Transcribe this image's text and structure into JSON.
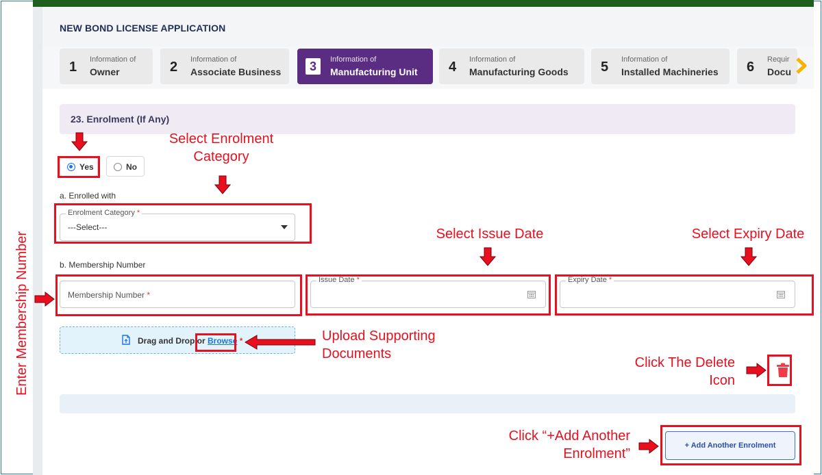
{
  "app": {
    "title": "NEW BOND LICENSE APPLICATION"
  },
  "steps": [
    {
      "num": "1",
      "small": "Information of",
      "big": "Owner",
      "active": false
    },
    {
      "num": "2",
      "small": "Information of",
      "big": "Associate Business",
      "active": false
    },
    {
      "num": "3",
      "small": "Information of",
      "big": "Manufacturing Unit",
      "active": true
    },
    {
      "num": "4",
      "small": "Information of",
      "big": "Manufacturing Goods",
      "active": false
    },
    {
      "num": "5",
      "small": "Information of",
      "big": "Installed Machineries",
      "active": false
    },
    {
      "num": "6",
      "small": "Requir",
      "big": "Docu",
      "active": false
    }
  ],
  "section": {
    "title": "23. Enrolment (If Any)"
  },
  "radio": {
    "yes_label": "Yes",
    "no_label": "No",
    "selected": "Yes"
  },
  "enrolled_with": {
    "label": "a. Enrolled with",
    "category_legend": "Enrolment Category",
    "category_value": "---Select---"
  },
  "membership": {
    "label": "b. Membership Number",
    "number_placeholder": "Membership Number",
    "issue_legend": "Issue Date",
    "expiry_legend": "Expiry Date"
  },
  "upload": {
    "prefix": "Drag and Drop or ",
    "browse": "Browse"
  },
  "required_mark": "*",
  "add_button": {
    "label": "+ Add Another Enrolment"
  },
  "annotations": {
    "select_category_1": "Select Enrolment",
    "select_category_2": "Category",
    "issue_date": "Select Issue Date",
    "expiry_date": "Select Expiry Date",
    "upload_1": "Upload Supporting",
    "upload_2": "Documents",
    "delete_1": "Click The Delete",
    "delete_2": "Icon",
    "add_1": "Click “+Add Another",
    "add_2": "Enrolment”",
    "membership": "Enter Membership Number"
  },
  "colors": {
    "annotation": "#e8101f",
    "active_step": "#5a2d82",
    "topbar": "#1e5e1e",
    "link": "#1a73e8"
  },
  "icons": [
    "calendar-icon",
    "upload-file-icon",
    "trash-icon",
    "chevron-right-icon",
    "caret-down-icon",
    "red-arrow-icon"
  ]
}
